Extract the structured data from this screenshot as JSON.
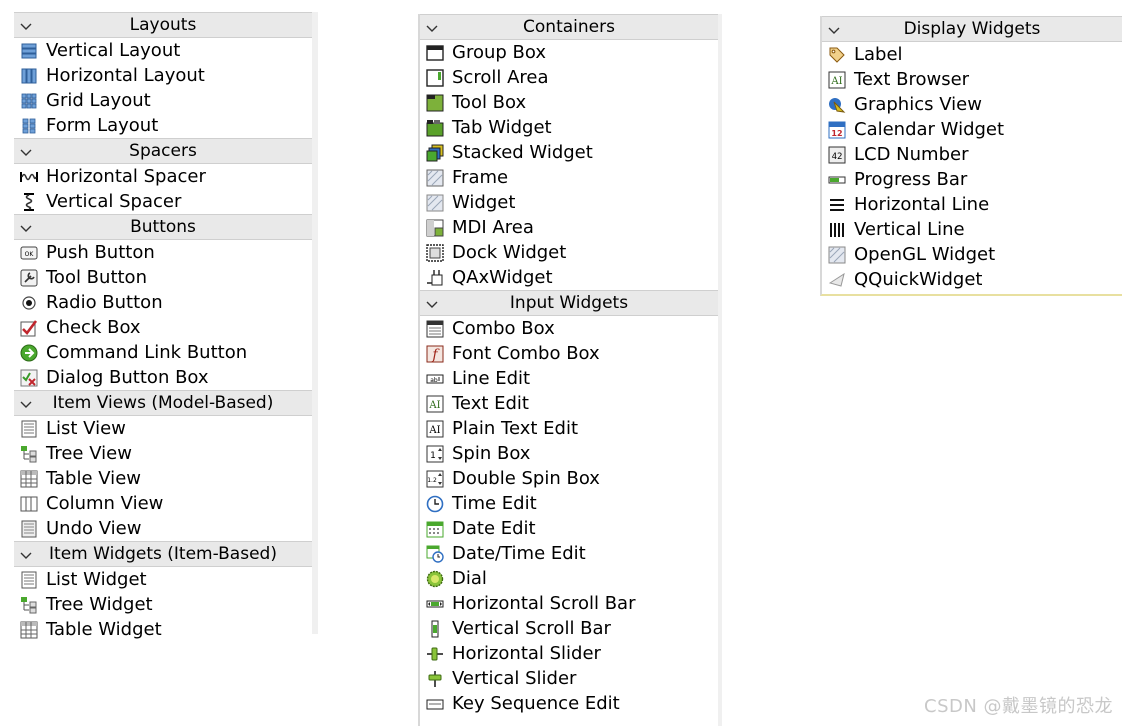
{
  "panels": [
    {
      "id": "left",
      "categories": [
        {
          "title": "Layouts",
          "items": [
            {
              "label": "Vertical Layout",
              "icon": "vertical-layout-icon"
            },
            {
              "label": "Horizontal Layout",
              "icon": "horizontal-layout-icon"
            },
            {
              "label": "Grid Layout",
              "icon": "grid-layout-icon"
            },
            {
              "label": "Form Layout",
              "icon": "form-layout-icon"
            }
          ]
        },
        {
          "title": "Spacers",
          "items": [
            {
              "label": "Horizontal Spacer",
              "icon": "horizontal-spacer-icon"
            },
            {
              "label": "Vertical Spacer",
              "icon": "vertical-spacer-icon"
            }
          ]
        },
        {
          "title": "Buttons",
          "items": [
            {
              "label": "Push Button",
              "icon": "push-button-icon"
            },
            {
              "label": "Tool Button",
              "icon": "tool-button-icon"
            },
            {
              "label": "Radio Button",
              "icon": "radio-button-icon"
            },
            {
              "label": "Check Box",
              "icon": "check-box-icon"
            },
            {
              "label": "Command Link Button",
              "icon": "command-link-icon"
            },
            {
              "label": "Dialog Button Box",
              "icon": "dialog-button-box-icon"
            }
          ]
        },
        {
          "title": "Item Views (Model-Based)",
          "items": [
            {
              "label": "List View",
              "icon": "list-view-icon"
            },
            {
              "label": "Tree View",
              "icon": "tree-view-icon"
            },
            {
              "label": "Table View",
              "icon": "table-view-icon"
            },
            {
              "label": "Column View",
              "icon": "column-view-icon"
            },
            {
              "label": "Undo View",
              "icon": "undo-view-icon"
            }
          ]
        },
        {
          "title": "Item Widgets (Item-Based)",
          "items": [
            {
              "label": "List Widget",
              "icon": "list-view-icon"
            },
            {
              "label": "Tree Widget",
              "icon": "tree-view-icon"
            },
            {
              "label": "Table Widget",
              "icon": "table-view-icon"
            }
          ]
        }
      ]
    },
    {
      "id": "mid",
      "categories": [
        {
          "title": "Containers",
          "items": [
            {
              "label": "Group Box",
              "icon": "group-box-icon"
            },
            {
              "label": "Scroll Area",
              "icon": "scroll-area-icon"
            },
            {
              "label": "Tool Box",
              "icon": "tool-box-icon"
            },
            {
              "label": "Tab Widget",
              "icon": "tab-widget-icon"
            },
            {
              "label": "Stacked Widget",
              "icon": "stacked-widget-icon"
            },
            {
              "label": "Frame",
              "icon": "frame-icon"
            },
            {
              "label": "Widget",
              "icon": "widget-icon"
            },
            {
              "label": "MDI Area",
              "icon": "mdi-area-icon"
            },
            {
              "label": "Dock Widget",
              "icon": "dock-widget-icon"
            },
            {
              "label": "QAxWidget",
              "icon": "qaxwidget-icon"
            }
          ]
        },
        {
          "title": "Input Widgets",
          "items": [
            {
              "label": "Combo Box",
              "icon": "combo-box-icon"
            },
            {
              "label": "Font Combo Box",
              "icon": "font-combo-box-icon"
            },
            {
              "label": "Line Edit",
              "icon": "line-edit-icon"
            },
            {
              "label": "Text Edit",
              "icon": "text-edit-icon"
            },
            {
              "label": "Plain Text Edit",
              "icon": "plain-text-edit-icon"
            },
            {
              "label": "Spin Box",
              "icon": "spin-box-icon"
            },
            {
              "label": "Double Spin Box",
              "icon": "double-spin-box-icon"
            },
            {
              "label": "Time Edit",
              "icon": "time-edit-icon"
            },
            {
              "label": "Date Edit",
              "icon": "date-edit-icon"
            },
            {
              "label": "Date/Time Edit",
              "icon": "date-time-edit-icon"
            },
            {
              "label": "Dial",
              "icon": "dial-icon"
            },
            {
              "label": "Horizontal Scroll Bar",
              "icon": "horizontal-scroll-bar-icon"
            },
            {
              "label": "Vertical Scroll Bar",
              "icon": "vertical-scroll-bar-icon"
            },
            {
              "label": "Horizontal Slider",
              "icon": "horizontal-slider-icon"
            },
            {
              "label": "Vertical Slider",
              "icon": "vertical-slider-icon"
            },
            {
              "label": "Key Sequence Edit",
              "icon": "key-sequence-edit-icon"
            }
          ]
        }
      ]
    },
    {
      "id": "right",
      "categories": [
        {
          "title": "Display Widgets",
          "items": [
            {
              "label": "Label",
              "icon": "label-icon"
            },
            {
              "label": "Text Browser",
              "icon": "text-browser-icon"
            },
            {
              "label": "Graphics View",
              "icon": "graphics-view-icon"
            },
            {
              "label": "Calendar Widget",
              "icon": "calendar-widget-icon"
            },
            {
              "label": "LCD Number",
              "icon": "lcd-number-icon"
            },
            {
              "label": "Progress Bar",
              "icon": "progress-bar-icon"
            },
            {
              "label": "Horizontal Line",
              "icon": "horizontal-line-icon"
            },
            {
              "label": "Vertical Line",
              "icon": "vertical-line-icon"
            },
            {
              "label": "OpenGL Widget",
              "icon": "opengl-widget-icon"
            },
            {
              "label": "QQuickWidget",
              "icon": "qquickwidget-icon"
            }
          ]
        }
      ]
    }
  ],
  "watermark": "CSDN @戴墨镜的恐龙",
  "colors": {
    "category_bg": "#e9e9e9",
    "accent_green": "#6a9a1f",
    "accent_blue": "#2f6fc2"
  }
}
